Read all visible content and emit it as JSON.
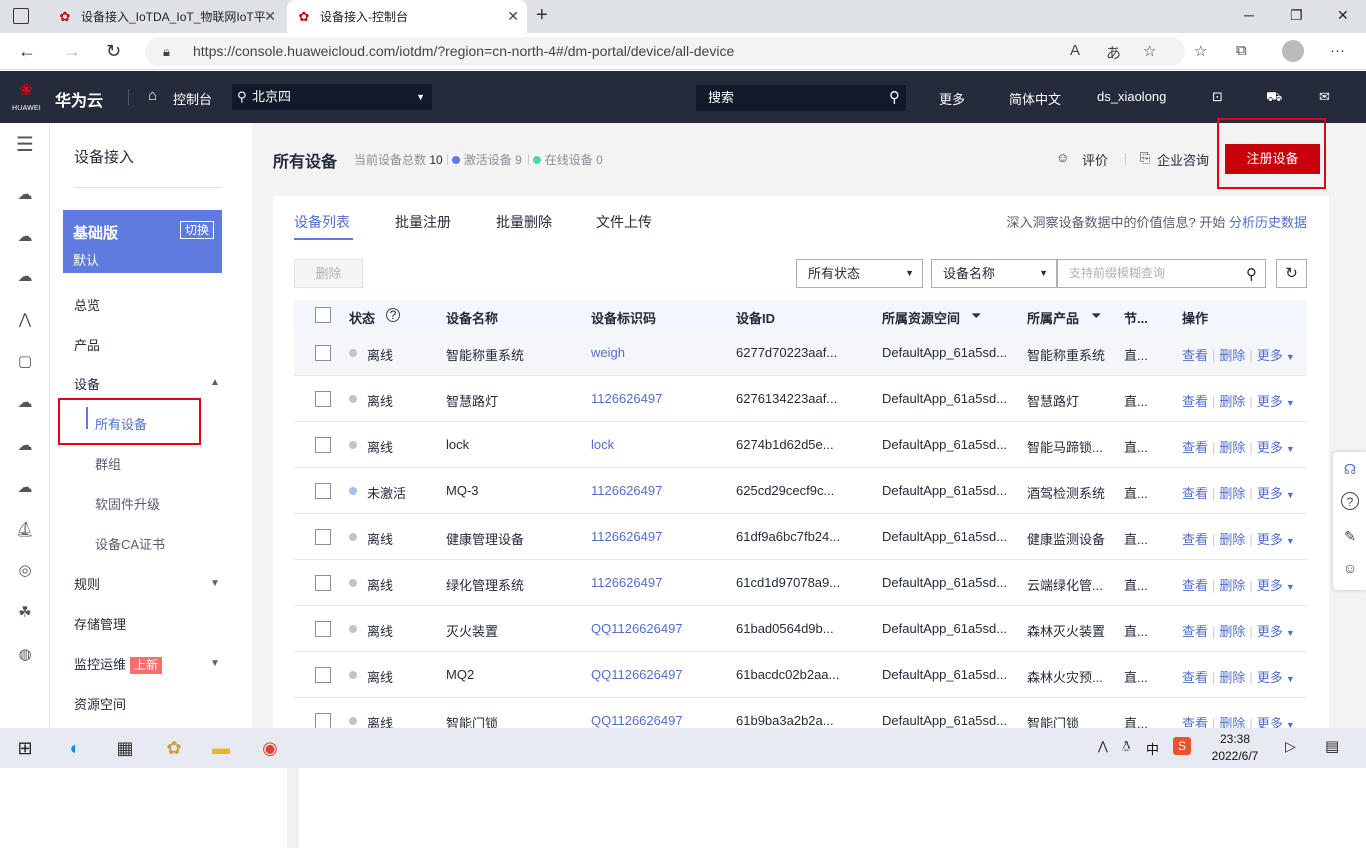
{
  "browser": {
    "tabs": [
      {
        "title": "设备接入_IoTDA_IoT_物联网IoT平"
      },
      {
        "title": "设备接入-控制台"
      }
    ],
    "url": "https://console.huaweicloud.com/iotdm/?region=cn-north-4#/dm-portal/device/all-device"
  },
  "topnav": {
    "logo_text": "HUAWEI",
    "brand": "华为云",
    "console": "控制台",
    "region": "北京四",
    "search_placeholder": "搜索",
    "more": "更多",
    "language": "简体中文",
    "user": "ds_xiaolong"
  },
  "sidebar": {
    "title": "设备接入",
    "plan_name": "基础版",
    "plan_desc": "默认",
    "plan_switch": "切换",
    "items": [
      {
        "label": "总览"
      },
      {
        "label": "产品"
      },
      {
        "label": "设备"
      },
      {
        "label": "所有设备"
      },
      {
        "label": "群组"
      },
      {
        "label": "软固件升级"
      },
      {
        "label": "设备CA证书"
      },
      {
        "label": "规则"
      },
      {
        "label": "存储管理"
      },
      {
        "label": "监控运维"
      },
      {
        "label": "资源空间"
      }
    ],
    "new_badge": "上新"
  },
  "main": {
    "title": "所有设备",
    "total_label": "当前设备总数",
    "total": "10",
    "active_label": "激活设备",
    "active": "9",
    "online_label": "在线设备",
    "online": "0",
    "rate": "评价",
    "consult": "企业咨询",
    "register_button": "注册设备",
    "tabs": [
      {
        "label": "设备列表"
      },
      {
        "label": "批量注册"
      },
      {
        "label": "批量删除"
      },
      {
        "label": "文件上传"
      }
    ],
    "insight_text": "深入洞察设备数据中的价值信息? 开始",
    "insight_link": "分析历史数据",
    "delete_button": "删除",
    "status_filter": "所有状态",
    "field_filter": "设备名称",
    "query_placeholder": "支持前缀模糊查询",
    "columns": [
      "状态",
      "设备名称",
      "设备标识码",
      "设备ID",
      "所属资源空间",
      "所属产品",
      "节...",
      "操作"
    ],
    "ops": {
      "view": "查看",
      "delete": "删除",
      "more": "更多"
    },
    "rows": [
      {
        "status": "离线",
        "name": "智能称重系统",
        "node": "weigh",
        "id": "6277d70223aaf...",
        "space": "DefaultApp_61a5sd...",
        "product": "智能称重系统",
        "node_type": "直..."
      },
      {
        "status": "离线",
        "name": "智慧路灯",
        "node": "1126626497",
        "id": "6276134223aaf...",
        "space": "DefaultApp_61a5sd...",
        "product": "智慧路灯",
        "node_type": "直..."
      },
      {
        "status": "离线",
        "name": "lock",
        "node": "lock",
        "id": "6274b1d62d5e...",
        "space": "DefaultApp_61a5sd...",
        "product": "智能马蹄锁...",
        "node_type": "直..."
      },
      {
        "status": "未激活",
        "name": "MQ-3",
        "node": "1126626497",
        "id": "625cd29cecf9c...",
        "space": "DefaultApp_61a5sd...",
        "product": "酒驾检测系统",
        "node_type": "直..."
      },
      {
        "status": "离线",
        "name": "健康管理设备",
        "node": "1126626497",
        "id": "61df9a6bc7fb24...",
        "space": "DefaultApp_61a5sd...",
        "product": "健康监测设备",
        "node_type": "直..."
      },
      {
        "status": "离线",
        "name": "绿化管理系统",
        "node": "1126626497",
        "id": "61cd1d97078a9...",
        "space": "DefaultApp_61a5sd...",
        "product": "云端绿化管...",
        "node_type": "直..."
      },
      {
        "status": "离线",
        "name": "灭火装置",
        "node": "QQ1126626497",
        "id": "61bad0564d9b...",
        "space": "DefaultApp_61a5sd...",
        "product": "森林灭火装置",
        "node_type": "直..."
      },
      {
        "status": "离线",
        "name": "MQ2",
        "node": "QQ1126626497",
        "id": "61bacdc02b2aa...",
        "space": "DefaultApp_61a5sd...",
        "product": "森林火灾预...",
        "node_type": "直..."
      },
      {
        "status": "离线",
        "name": "智能门锁",
        "node": "QQ1126626497",
        "id": "61b9ba3a2b2a...",
        "space": "DefaultApp_61a5sd...",
        "product": "智能门锁",
        "node_type": "直..."
      }
    ]
  },
  "taskbar": {
    "time": "23:38",
    "date": "2022/6/7",
    "ime": "中"
  },
  "colors": {
    "accent": "#5e7ce0",
    "brand_red": "#c7000b",
    "nav_bg": "#252b3a",
    "highlight": "#e60012"
  }
}
